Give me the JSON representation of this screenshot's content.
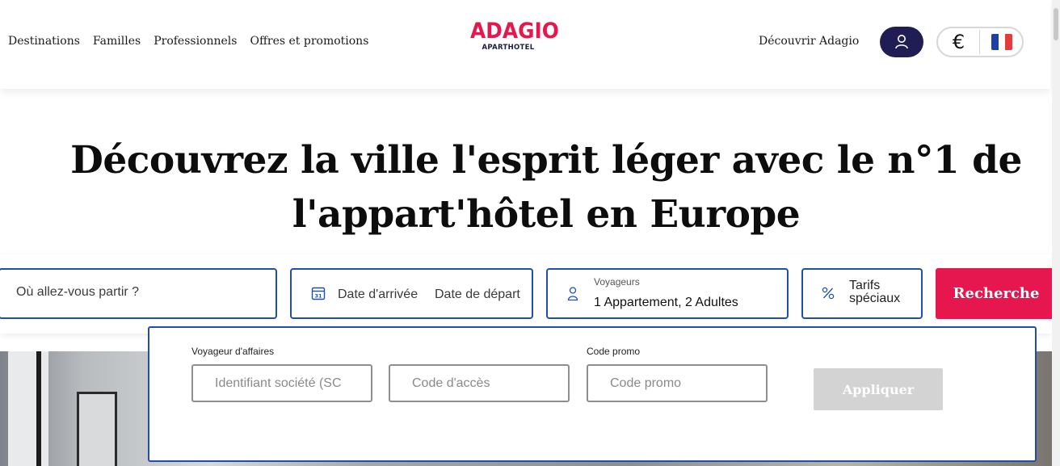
{
  "header": {
    "nav": [
      "Destinations",
      "Familles",
      "Professionnels",
      "Offres et promotions"
    ],
    "logo_main": "ADAGIO",
    "logo_sub": "APARTHOTEL",
    "discover": "Découvrir Adagio",
    "currency": "€",
    "flag_colors": [
      "#1f3fa8",
      "#ffffff",
      "#e53b3b"
    ],
    "brand_color": "#e5174e",
    "dark_color": "#1f1d54"
  },
  "hero": {
    "title_line1": "Découvrez la ville l'esprit léger avec le n°1 de",
    "title_line2": "l'appart'hôtel en Europe"
  },
  "search": {
    "where_placeholder": "Où allez-vous partir ?",
    "checkin": "Date d'arrivée",
    "checkout": "Date de départ",
    "guests_label": "Voyageurs",
    "guests_value": "1 Appartement, 2 Adultes",
    "rates_line1": "Tarifs",
    "rates_line2": "spéciaux",
    "button": "Recherche",
    "accent": "#1f4fa8"
  },
  "promo": {
    "business_label": "Voyageur d'affaires",
    "company_placeholder": "Identifiant société (SC",
    "access_placeholder": "Code d'accès",
    "promo_label": "Code promo",
    "promo_placeholder": "Code promo",
    "apply_button": "Appliquer"
  }
}
